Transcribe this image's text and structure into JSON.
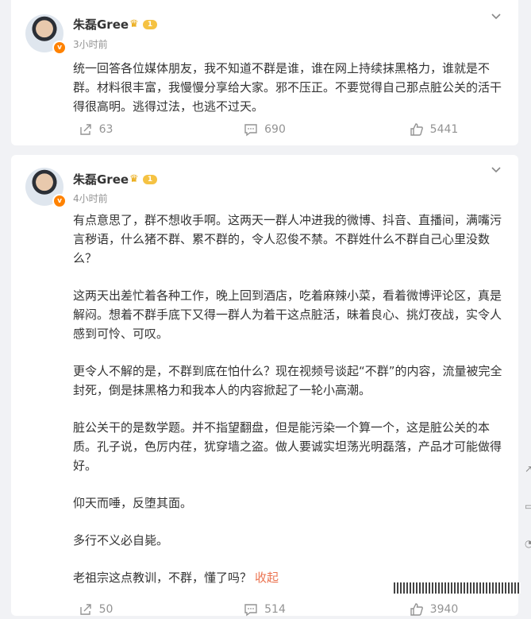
{
  "posts": [
    {
      "author": "朱磊Gree",
      "level": "1",
      "time": "3小时前",
      "paragraphs": [
        "统一回答各位媒体朋友，我不知道不群是谁，谁在网上持续抹黑格力，谁就是不群。材料很丰富，我慢慢分享给大家。邪不压正。不要觉得自己那点脏公关的活干得很高明。逃得过法，也逃不过天。"
      ],
      "reposts": "63",
      "comments": "690",
      "likes": "5441"
    },
    {
      "author": "朱磊Gree",
      "level": "1",
      "time": "4小时前",
      "paragraphs": [
        "有点意思了，群不想收手啊。这两天一群人冲进我的微博、抖音、直播间，满嘴污言秽语，什么猪不群、累不群的，令人忍俊不禁。不群姓什么不群自己心里没数么？",
        "这两天出差忙着各种工作，晚上回到酒店，吃着麻辣小菜，看着微博评论区，真是解闷。想着不群手底下又得一群人为着干这点脏活，昧着良心、挑灯夜战，实令人感到可怜、可叹。",
        "更令人不解的是，不群到底在怕什么？现在视频号谈起“不群”的内容，流量被完全封死，倒是抹黑格力和我本人的内容掀起了一轮小高潮。",
        "脏公关干的是数学题。并不指望翻盘，但是能污染一个算一个，这是脏公关的本质。孔子说，色厉内荏，犹穿墙之盗。做人要诚实坦荡光明磊落，产品才可能做得好。",
        "仰天而唾，反堕其面。",
        "多行不义必自毙。",
        "老祖宗这点教训，不群，懂了吗？"
      ],
      "collapse_label": "收起",
      "reposts": "50",
      "comments": "514",
      "likes": "3940"
    }
  ]
}
